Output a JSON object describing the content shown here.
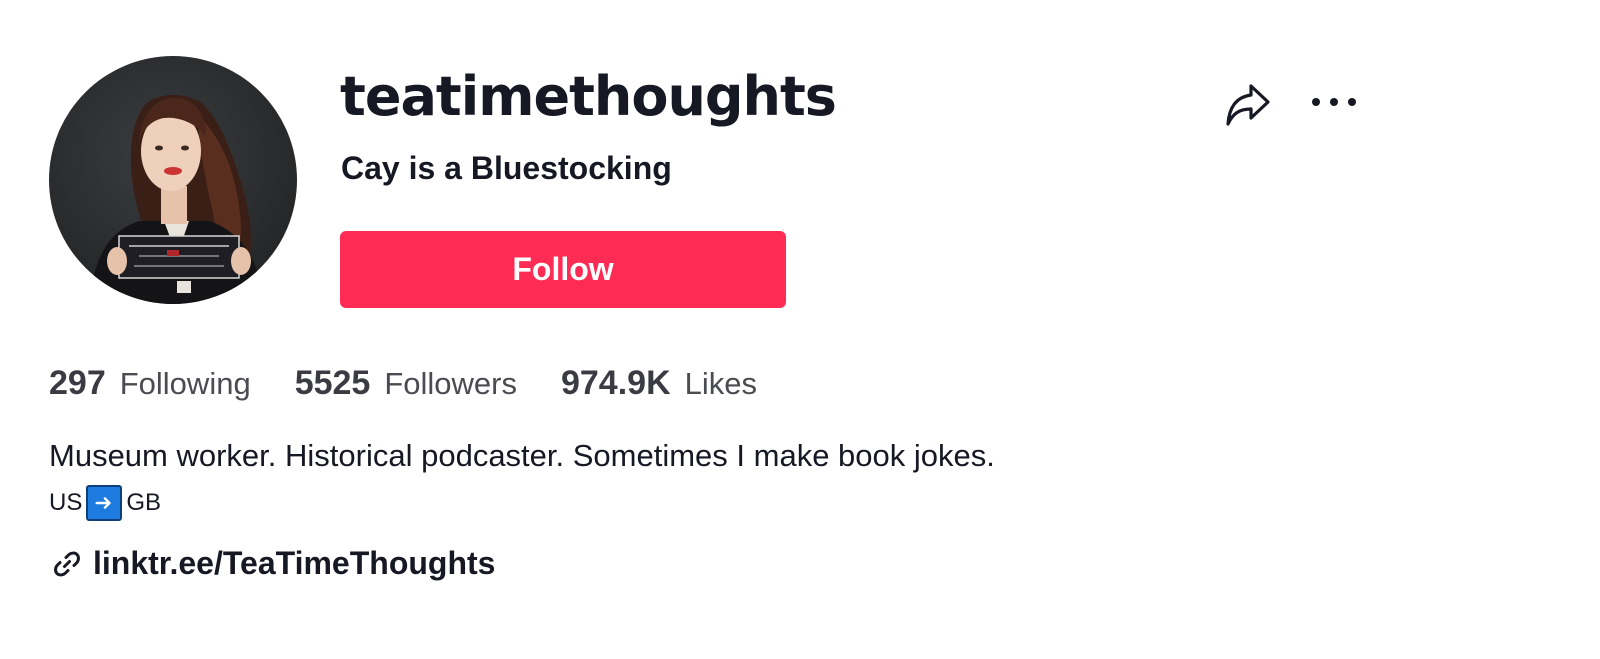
{
  "profile": {
    "username": "teatimethoughts",
    "nickname": "Cay is a Bluestocking",
    "avatar_alt": "profile photo"
  },
  "actions": {
    "follow_label": "Follow",
    "share_icon": "share-icon",
    "more_icon": "more-options-icon"
  },
  "stats": {
    "following_count": "297",
    "following_label": "Following",
    "followers_count": "5525",
    "followers_label": "Followers",
    "likes_count": "974.9K",
    "likes_label": "Likes"
  },
  "bio": {
    "line1": "Museum worker. Historical podcaster. Sometimes I make book jokes.",
    "from": "US",
    "arrow_icon": "right-arrow-emoji-icon",
    "to": "GB"
  },
  "link": {
    "icon": "link-icon",
    "text": "linktr.ee/TeaTimeThoughts"
  },
  "colors": {
    "accent": "#fe2c55",
    "text_primary": "#161823",
    "text_secondary": "#4b4c52",
    "emoji_blue": "#1e7be0"
  }
}
